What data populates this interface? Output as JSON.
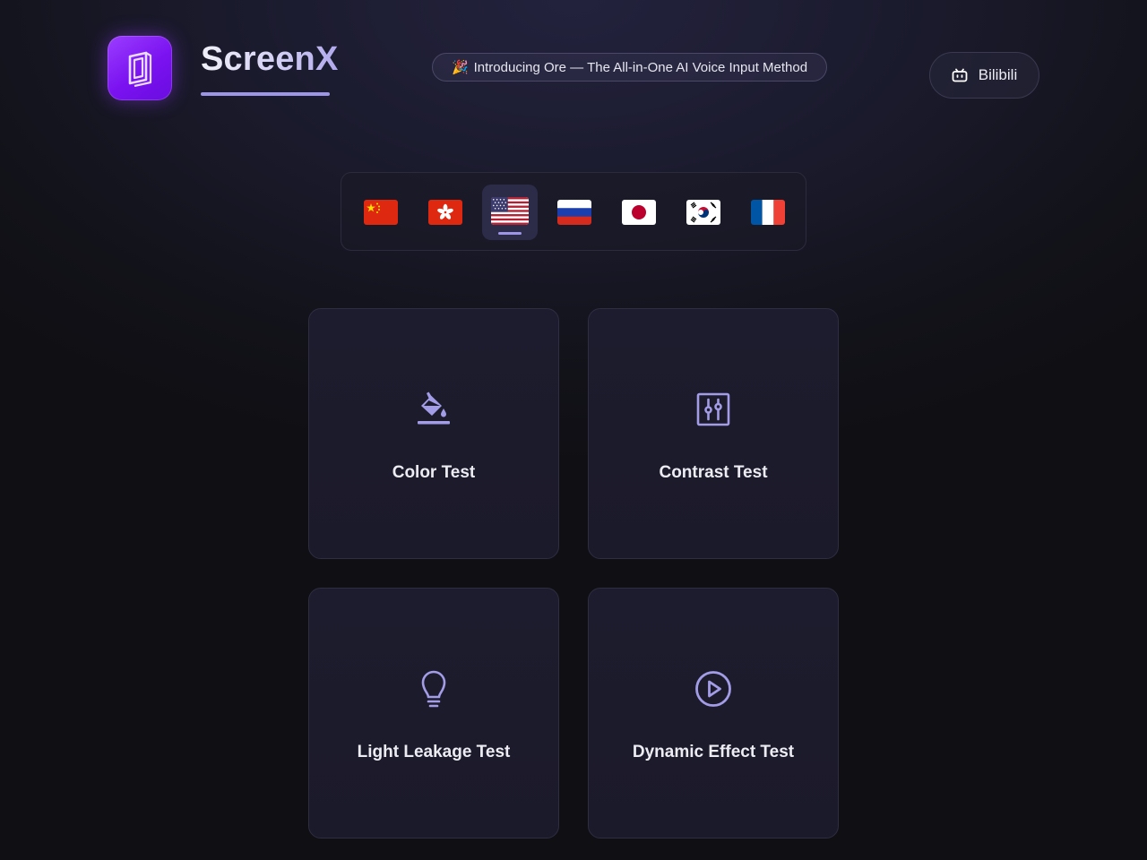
{
  "header": {
    "brand_name": "ScreenX",
    "logo_icon": "book-icon",
    "announcement": {
      "emoji": "🎉",
      "text": "Introducing Ore — The All-in-One AI Voice Input Method"
    },
    "bilibili_button": {
      "icon": "bilibili-tv-icon",
      "label": "Bilibili"
    }
  },
  "languages": {
    "selected": "us",
    "items": [
      {
        "id": "cn",
        "name": "China",
        "icon": "china-flag-icon"
      },
      {
        "id": "hk",
        "name": "Hong Kong",
        "icon": "hong-kong-flag-icon"
      },
      {
        "id": "us",
        "name": "United States",
        "icon": "usa-flag-icon"
      },
      {
        "id": "ru",
        "name": "Russia",
        "icon": "russia-flag-icon"
      },
      {
        "id": "jp",
        "name": "Japan",
        "icon": "japan-flag-icon"
      },
      {
        "id": "kr",
        "name": "South Korea",
        "icon": "korea-flag-icon"
      },
      {
        "id": "fr",
        "name": "France",
        "icon": "france-flag-icon"
      }
    ]
  },
  "cards": [
    {
      "label": "Color Test",
      "icon": "paint-bucket-icon"
    },
    {
      "label": "Contrast Test",
      "icon": "sliders-icon"
    },
    {
      "label": "Light Leakage Test",
      "icon": "lightbulb-icon"
    },
    {
      "label": "Dynamic Effect Test",
      "icon": "play-circle-icon"
    }
  ],
  "colors": {
    "accent": "#9d96e8",
    "logo_gradient_start": "#9b3dff",
    "logo_gradient_end": "#6a0ce0",
    "card_background": "#1c1b2c",
    "page_background": "#121219"
  }
}
